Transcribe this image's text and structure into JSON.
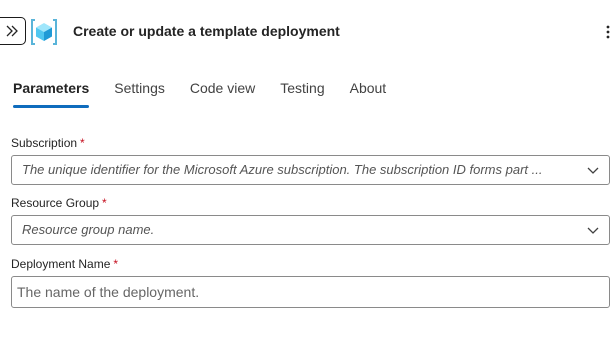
{
  "header": {
    "title": "Create or update a template deployment",
    "collapse_icon": "double-chevron-right-icon",
    "app_icon": "azure-template-icon",
    "more_icon": "more-vertical-icon"
  },
  "tabs": [
    {
      "label": "Parameters",
      "active": true
    },
    {
      "label": "Settings",
      "active": false
    },
    {
      "label": "Code view",
      "active": false
    },
    {
      "label": "Testing",
      "active": false
    },
    {
      "label": "About",
      "active": false
    }
  ],
  "fields": {
    "subscription": {
      "label": "Subscription",
      "required_mark": "*",
      "placeholder": "The unique identifier for the  Microsoft Azure subscription. The subscription ID forms part ..."
    },
    "resource_group": {
      "label": "Resource Group",
      "required_mark": "*",
      "placeholder": "Resource group name."
    },
    "deployment_name": {
      "label": "Deployment Name",
      "required_mark": "*",
      "placeholder": "The name of the deployment.",
      "value": ""
    }
  },
  "colors": {
    "accent": "#0f6cbd",
    "required": "#c50f1f",
    "border": "#8a8a8a"
  }
}
